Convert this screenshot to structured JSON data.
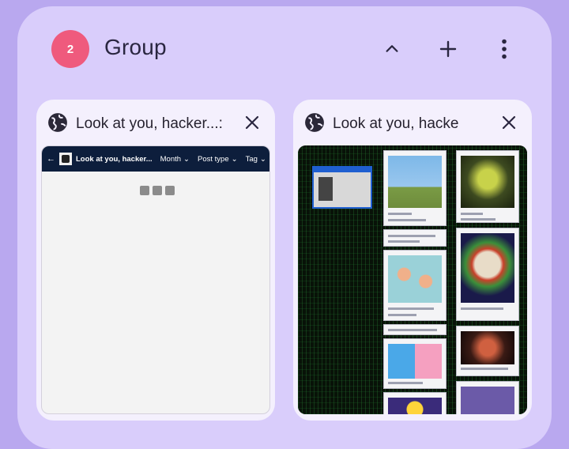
{
  "group": {
    "count": "2",
    "title": "Group"
  },
  "icons": {
    "collapse": "chevron-up-icon",
    "add": "plus-icon",
    "more": "more-vert-icon",
    "globe": "globe-icon",
    "close": "close-icon"
  },
  "colors": {
    "panel": "#d9cdfb",
    "badge": "#ef5a7d",
    "background": "#b9a8ef",
    "site_bar": "#0d1e3c"
  },
  "tabs": [
    {
      "title": "Look at you, hacker...: ...",
      "thumbnail": {
        "site_name": "Look at you, hacker...",
        "filters": [
          "Month",
          "Post type",
          "Tag"
        ]
      }
    },
    {
      "title": "Look at you, hacke"
    }
  ]
}
